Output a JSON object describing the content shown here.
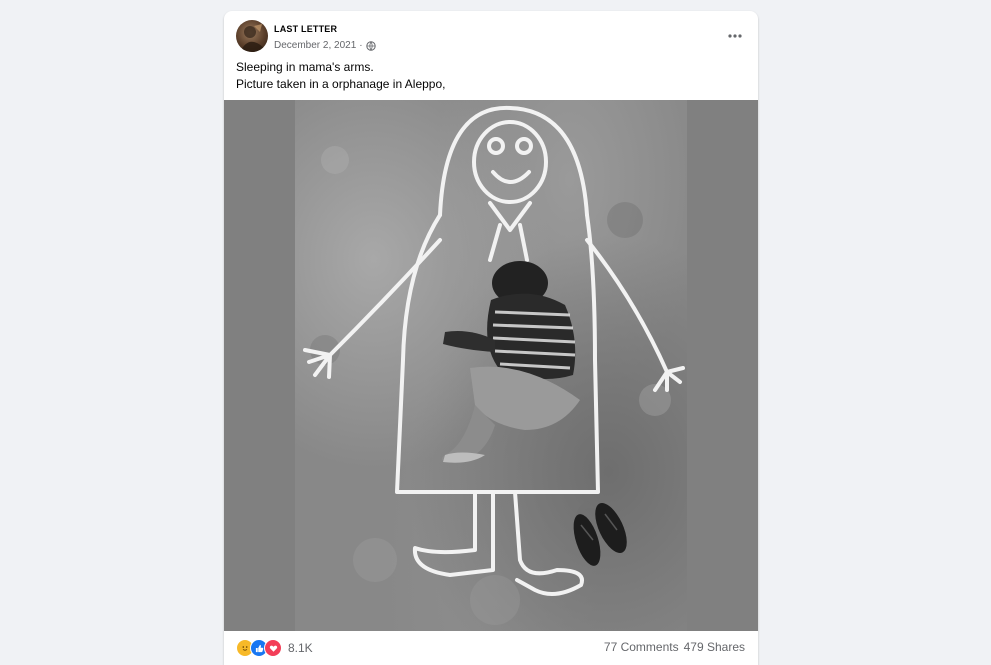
{
  "post": {
    "author": "LAST LETTER",
    "date": "December 2, 2021",
    "separator": "·",
    "caption_line1": "Sleeping in mama's arms.",
    "caption_line2": "Picture taken in a orphanage in Aleppo,",
    "more_icon": "more-horizontal-icon",
    "privacy_icon": "globe-icon"
  },
  "engagement": {
    "reaction_icons": [
      "care-icon",
      "like-icon",
      "love-icon"
    ],
    "reaction_count": "8.1K",
    "comments": "77 Comments",
    "shares": "479 Shares"
  },
  "colors": {
    "page_bg": "#f0f2f5",
    "card_bg": "#ffffff",
    "secondary_text": "#65676b",
    "like_blue": "#1877f2",
    "love_red": "#f33e58",
    "care_yellow": "#f7b928"
  }
}
